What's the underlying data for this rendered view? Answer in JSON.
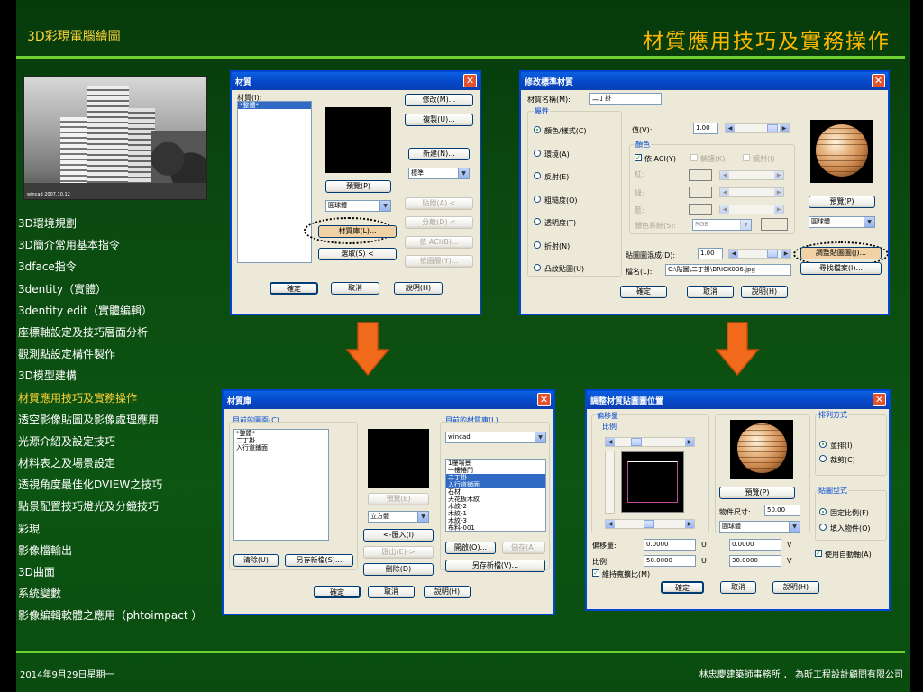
{
  "header": {
    "left": "3D彩現電腦繪圖",
    "title": "材質應用技巧及實務操作"
  },
  "photo": {
    "watermark": "wincad 2007.10.12"
  },
  "menu": [
    {
      "label": "3D環境規劃",
      "active": false
    },
    {
      "label": "3D簡介常用基本指令",
      "active": false
    },
    {
      "label": "3dface指令",
      "active": false
    },
    {
      "label": "3dentity（實體）",
      "active": false
    },
    {
      "label": "3dentity edit（實體編輯）",
      "active": false
    },
    {
      "label": "座標軸設定及技巧層面分析",
      "active": false
    },
    {
      "label": "觀測點設定構件製作",
      "active": false
    },
    {
      "label": "3D模型建構",
      "active": false
    },
    {
      "label": "材質應用技巧及實務操作",
      "active": true
    },
    {
      "label": "透空影像貼圖及影像處理應用",
      "active": false
    },
    {
      "label": "光源介紹及設定技巧",
      "active": false
    },
    {
      "label": "材料表之及場景設定",
      "active": false
    },
    {
      "label": "透視角度最佳化DVIEW之技巧",
      "active": false
    },
    {
      "label": "點景配置技巧燈光及分鏡技巧",
      "active": false
    },
    {
      "label": "彩現",
      "active": false
    },
    {
      "label": "影像檔輸出",
      "active": false
    },
    {
      "label": "3D曲面",
      "active": false
    },
    {
      "label": "系統變數",
      "active": false
    },
    {
      "label": "影像編輯軟體之應用（phtoimpact ）",
      "active": false
    }
  ],
  "dlg1": {
    "title": "材質",
    "list_label": "材質(I):",
    "list_items": [
      "*整體*"
    ],
    "preview": "預覽(P)",
    "combo": "圓球體",
    "library": "材質庫(L)...",
    "select": "選取(S) <",
    "modify": "修改(M)...",
    "duplicate": "複製(U)...",
    "new": "新建(N)...",
    "type": "標準",
    "attach": "貼附(A) <",
    "detach": "分離(D) <",
    "by_aci": "依 ACI(B)...",
    "by_layer": "依圖層(Y)...",
    "ok": "確定",
    "cancel": "取消",
    "help": "說明(H)"
  },
  "dlg2": {
    "title": "修改標準材質",
    "name_label": "材質名稱(M):",
    "name_value": "二丁掛",
    "attr_group": "屬性",
    "attrs": [
      "顏色/樣式(C)",
      "環境(A)",
      "反射(E)",
      "粗糙度(O)",
      "透明度(T)",
      "折射(N)",
      "凸紋貼圖(U)"
    ],
    "value_label": "值(V):",
    "value": "1.00",
    "color_group": "顏色",
    "by_aci": "依 ACI(Y)",
    "lock": "鎖護(K)",
    "mirror": "鏡射(I)",
    "red": "紅:",
    "green": "綠:",
    "blue": "藍:",
    "color_system": "顏色系統(S):",
    "color_system_value": "RGB",
    "preview": "預覽(P)",
    "sphere": "圓球體",
    "blend_label": "貼圖圖混成(D):",
    "blend_value": "1.00",
    "file_label": "檔名(L):",
    "file_value": "C:\\貼圖\\二丁掛\\BRICK036.jpg",
    "adjust": "調整貼圖圖(J)...",
    "find": "尋找檔案(I)...",
    "ok": "確定",
    "cancel": "取消",
    "help": "說明(H)"
  },
  "dlg3": {
    "title": "材質庫",
    "current_label": "目前的圖面(C)",
    "current_items": [
      "*整體*",
      "二丁掛",
      "入行道鋪面"
    ],
    "preview": "預覽(E)",
    "shape": "立方體",
    "import": "<-匯入(I)",
    "export": "匯出(E)->",
    "delete": "刪除(D)",
    "purge": "清除(U)",
    "save_as": "另存新檔(S)...",
    "lib_label": "目前的材質庫(L)",
    "lib_combo": "wincad",
    "lib_items": [
      "1樓場景",
      "一樓捲門",
      "二丁掛",
      "入行道鋪面",
      "石材",
      "天花板木紋",
      "木紋-2",
      "木紋-1",
      "木紋-3",
      "布料-001"
    ],
    "lib_selected": [
      2,
      3
    ],
    "open": "開啟(O)...",
    "save": "儲存(A)",
    "save_as2": "另存新檔(V)...",
    "ok": "確定",
    "cancel": "取消",
    "help": "說明(H)"
  },
  "dlg4": {
    "title": "調整材質貼圖圖位置",
    "offset_group": "偏移量",
    "scale_sub": "比例",
    "preview": "預覽(P)",
    "obj_size_label": "物件尺寸:",
    "obj_size": "50.00",
    "sphere": "圓球體",
    "offset_label": "偏移量:",
    "offset_u": "0.0000",
    "offset_v": "0.0000",
    "scale_label": "比例:",
    "scale_u": "50.0000",
    "scale_v": "30.0000",
    "u": "U",
    "v": "V",
    "keep_ratio": "維持寬擴比(M)",
    "tiling_group": "排列方式",
    "tile": "並排(I)",
    "crop": "裁剪(C)",
    "map_group": "貼圖型式",
    "fixed": "固定比例(F)",
    "fit": "填入物件(O)",
    "auto_axis": "使用自動軸(A)",
    "ok": "確定",
    "cancel": "取消",
    "help": "說明(H)"
  },
  "footer": {
    "date": "2014年9月29日星期一",
    "credit": "林忠慶建築師事務所 ． 為昕工程設計顧問有限公司"
  },
  "colors": {
    "title": "#ffb800",
    "accent_line": "#6ccf33",
    "arrow": "#f26a1b",
    "header": "#ffd33a"
  }
}
